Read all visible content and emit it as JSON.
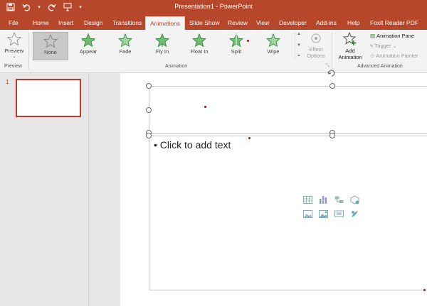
{
  "window": {
    "title": "Presentation1  -  PowerPoint"
  },
  "qat": {
    "save": "save-icon",
    "undo": "undo-icon",
    "redo": "redo-icon",
    "present": "start-from-beginning-icon",
    "more": "▾"
  },
  "tabs": [
    "File",
    "Home",
    "Insert",
    "Design",
    "Transitions",
    "Animations",
    "Slide Show",
    "Review",
    "View",
    "Developer",
    "Add-ins",
    "Help",
    "Foxit Reader PDF"
  ],
  "ribbon": {
    "preview_label": "Preview",
    "preview_group": "Preview",
    "animations": [
      "None",
      "Appear",
      "Fade",
      "Fly In",
      "Float In",
      "Split",
      "Wipe"
    ],
    "effect_options": "Effect Options",
    "animation_group": "Animation",
    "add_animation": "Add Animation",
    "animation_pane": "Animation Pane",
    "trigger": "Trigger",
    "animation_painter": "Animation Painter",
    "advanced_group": "Advanced Animation"
  },
  "slides": {
    "number": "1"
  },
  "slide": {
    "body_placeholder": "Click to add text"
  },
  "colors": {
    "accent": "#b7472a",
    "selected_slide": "#c0392b"
  }
}
